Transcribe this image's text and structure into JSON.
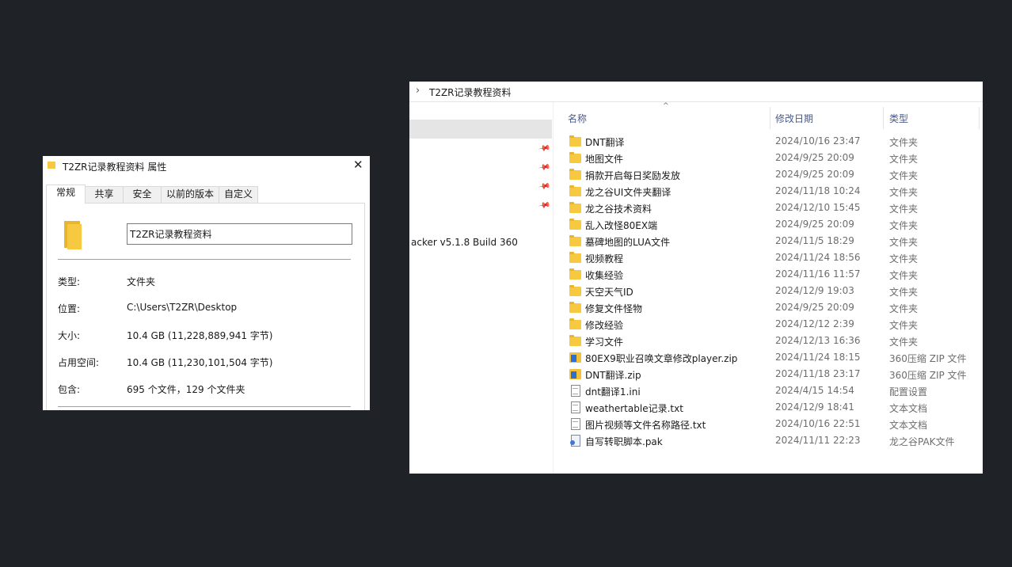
{
  "explorer": {
    "breadcrumb": "T2ZR记录教程资料",
    "nav_fragment": "acker v5.1.8 Build 360",
    "columns": {
      "name": "名称",
      "date": "修改日期",
      "type": "类型"
    },
    "files": [
      {
        "name": "DNT翻译",
        "date": "2024/10/16 23:47",
        "type": "文件夹",
        "icon": "folder"
      },
      {
        "name": "地图文件",
        "date": "2024/9/25 20:09",
        "type": "文件夹",
        "icon": "folder"
      },
      {
        "name": "捐款开启每日奖励发放",
        "date": "2024/9/25 20:09",
        "type": "文件夹",
        "icon": "folder"
      },
      {
        "name": "龙之谷UI文件夹翻译",
        "date": "2024/11/18 10:24",
        "type": "文件夹",
        "icon": "folder"
      },
      {
        "name": "龙之谷技术资料",
        "date": "2024/12/10 15:45",
        "type": "文件夹",
        "icon": "folder"
      },
      {
        "name": "乱入改怪80EX端",
        "date": "2024/9/25 20:09",
        "type": "文件夹",
        "icon": "folder"
      },
      {
        "name": "墓碑地图的LUA文件",
        "date": "2024/11/5 18:29",
        "type": "文件夹",
        "icon": "folder"
      },
      {
        "name": "视频教程",
        "date": "2024/11/24 18:56",
        "type": "文件夹",
        "icon": "folder"
      },
      {
        "name": "收集经验",
        "date": "2024/11/16 11:57",
        "type": "文件夹",
        "icon": "folder"
      },
      {
        "name": "天空天气ID",
        "date": "2024/12/9 19:03",
        "type": "文件夹",
        "icon": "folder"
      },
      {
        "name": "修复文件怪物",
        "date": "2024/9/25 20:09",
        "type": "文件夹",
        "icon": "folder"
      },
      {
        "name": "修改经验",
        "date": "2024/12/12 2:39",
        "type": "文件夹",
        "icon": "folder"
      },
      {
        "name": "学习文件",
        "date": "2024/12/13 16:36",
        "type": "文件夹",
        "icon": "folder"
      },
      {
        "name": "80EX9职业召唤文章修改player.zip",
        "date": "2024/11/24 18:15",
        "type": "360压缩 ZIP 文件",
        "icon": "zip"
      },
      {
        "name": "DNT翻译.zip",
        "date": "2024/11/18 23:17",
        "type": "360压缩 ZIP 文件",
        "icon": "zip"
      },
      {
        "name": "dnt翻译1.ini",
        "date": "2024/4/15 14:54",
        "type": "配置设置",
        "icon": "doc"
      },
      {
        "name": "weathertable记录.txt",
        "date": "2024/12/9 18:41",
        "type": "文本文档",
        "icon": "doc"
      },
      {
        "name": "图片视频等文件名称路径.txt",
        "date": "2024/10/16 22:51",
        "type": "文本文档",
        "icon": "doc"
      },
      {
        "name": "自写转职脚本.pak",
        "date": "2024/11/11 22:23",
        "type": "龙之谷PAK文件",
        "icon": "pak"
      }
    ]
  },
  "props": {
    "title": "T2ZR记录教程资料 属性",
    "tabs": [
      "常规",
      "共享",
      "安全",
      "以前的版本",
      "自定义"
    ],
    "folder_name": "T2ZR记录教程资料",
    "rows": [
      {
        "label": "类型:",
        "value": "文件夹"
      },
      {
        "label": "位置:",
        "value": "C:\\Users\\T2ZR\\Desktop"
      },
      {
        "label": "大小:",
        "value": "10.4 GB (11,228,889,941 字节)"
      },
      {
        "label": "占用空间:",
        "value": "10.4 GB (11,230,101,504 字节)"
      },
      {
        "label": "包含:",
        "value": "695 个文件，129 个文件夹"
      }
    ]
  }
}
